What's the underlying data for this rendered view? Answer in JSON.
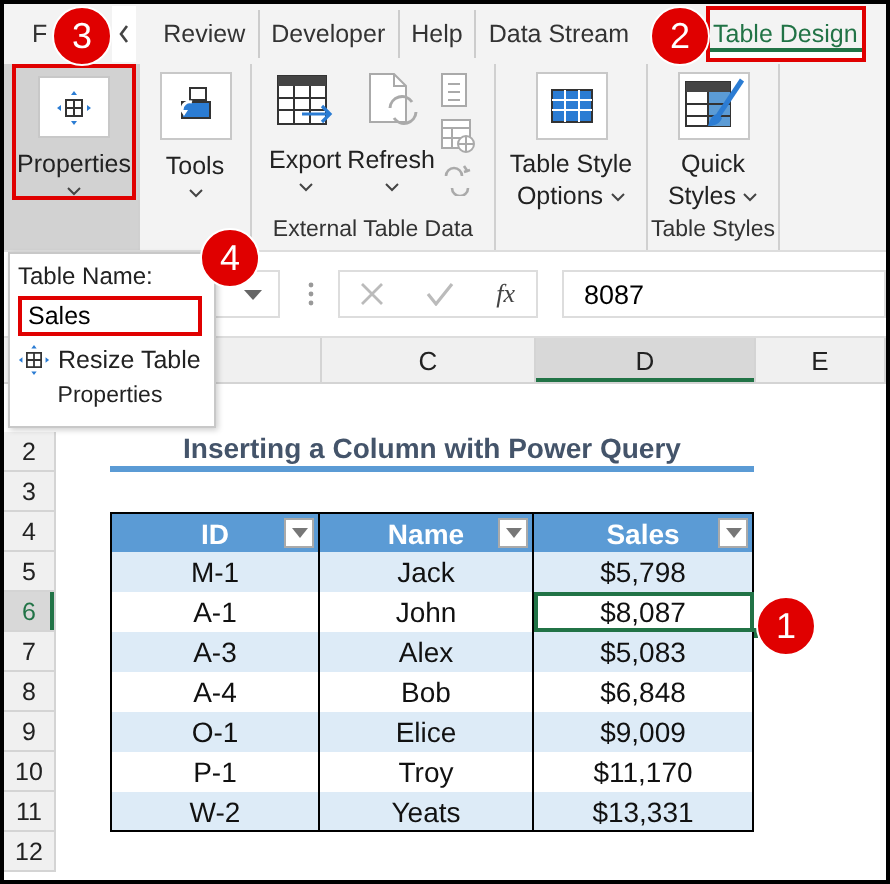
{
  "ribbon_tabs": [
    {
      "label": "F",
      "selected": false
    },
    {
      "label": "Review",
      "selected": false
    },
    {
      "label": "Developer",
      "selected": false
    },
    {
      "label": "Help",
      "selected": false
    },
    {
      "label": "Data Stream",
      "selected": false
    },
    {
      "label": "Table Design",
      "selected": true
    }
  ],
  "ribbon_groups": [
    {
      "buttons": [
        {
          "label": "Properties",
          "kind": "stacked",
          "selected": true
        }
      ]
    },
    {
      "buttons": [
        {
          "label": "Tools",
          "kind": "stacked",
          "selected": false
        }
      ]
    },
    {
      "label": "External Table Data",
      "buttons": [
        {
          "label": "Export",
          "kind": "stacked",
          "selected": false
        },
        {
          "label": "Refresh",
          "kind": "stacked",
          "selected": false
        }
      ]
    },
    {
      "buttons": [
        {
          "label": "Table Style Options",
          "kind": "wrapped",
          "selected": false
        }
      ]
    },
    {
      "label": "Table Styles",
      "buttons": [
        {
          "label": "Quick Styles",
          "kind": "wrapped",
          "selected": false
        }
      ]
    }
  ],
  "popup": {
    "label": "Table Name:",
    "value": "Sales",
    "resize": "Resize Table",
    "group_label": "Properties"
  },
  "formula_bar": {
    "function_label": "fx",
    "value": "8087"
  },
  "columns": [
    {
      "label": "C",
      "selected": false
    },
    {
      "label": "D",
      "selected": true
    },
    {
      "label": "E",
      "selected": false
    }
  ],
  "row_numbers": [
    {
      "label": "2",
      "selected": false
    },
    {
      "label": "3",
      "selected": false
    },
    {
      "label": "4",
      "selected": false
    },
    {
      "label": "5",
      "selected": false
    },
    {
      "label": "6",
      "selected": true
    },
    {
      "label": "7",
      "selected": false
    },
    {
      "label": "8",
      "selected": false
    },
    {
      "label": "9",
      "selected": false
    },
    {
      "label": "10",
      "selected": false
    },
    {
      "label": "11",
      "selected": false
    },
    {
      "label": "12",
      "selected": false
    }
  ],
  "title": "Inserting a Column with Power Query",
  "table": {
    "columns": [
      "ID",
      "Name",
      "Sales"
    ],
    "rows": [
      {
        "cells": [
          {
            "text": "M-1",
            "selected": false
          },
          {
            "text": "Jack",
            "selected": false
          },
          {
            "text": "$5,798",
            "selected": false
          }
        ]
      },
      {
        "cells": [
          {
            "text": "A-1",
            "selected": false
          },
          {
            "text": "John",
            "selected": false
          },
          {
            "text": "$8,087",
            "selected": true
          }
        ]
      },
      {
        "cells": [
          {
            "text": "A-3",
            "selected": false
          },
          {
            "text": "Alex",
            "selected": false
          },
          {
            "text": "$5,083",
            "selected": false
          }
        ]
      },
      {
        "cells": [
          {
            "text": "A-4",
            "selected": false
          },
          {
            "text": "Bob",
            "selected": false
          },
          {
            "text": "$6,848",
            "selected": false
          }
        ]
      },
      {
        "cells": [
          {
            "text": "O-1",
            "selected": false
          },
          {
            "text": "Elice",
            "selected": false
          },
          {
            "text": "$9,009",
            "selected": false
          }
        ]
      },
      {
        "cells": [
          {
            "text": "P-1",
            "selected": false
          },
          {
            "text": "Troy",
            "selected": false
          },
          {
            "text": "$11,170",
            "selected": false
          }
        ]
      },
      {
        "cells": [
          {
            "text": "W-2",
            "selected": false
          },
          {
            "text": "Yeats",
            "selected": false
          },
          {
            "text": "$13,331",
            "selected": false
          }
        ]
      }
    ]
  },
  "callouts": [
    "3",
    "2",
    "4",
    "1"
  ]
}
